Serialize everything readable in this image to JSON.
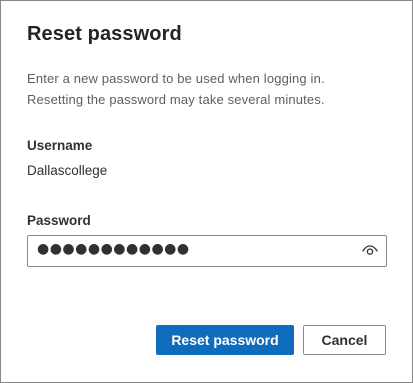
{
  "dialog": {
    "title": "Reset password",
    "description_line1": "Enter a new password to be used when logging in.",
    "description_line2": "Resetting the password may take several minutes."
  },
  "username": {
    "label": "Username",
    "value": "Dallascollege"
  },
  "password": {
    "label": "Password",
    "masked_value": "●●●●●●●●●●●●",
    "reveal_icon": "eye-icon"
  },
  "buttons": {
    "reset_label": "Reset password",
    "cancel_label": "Cancel"
  },
  "colors": {
    "primary": "#0f6cbd",
    "border": "#8a8886"
  }
}
